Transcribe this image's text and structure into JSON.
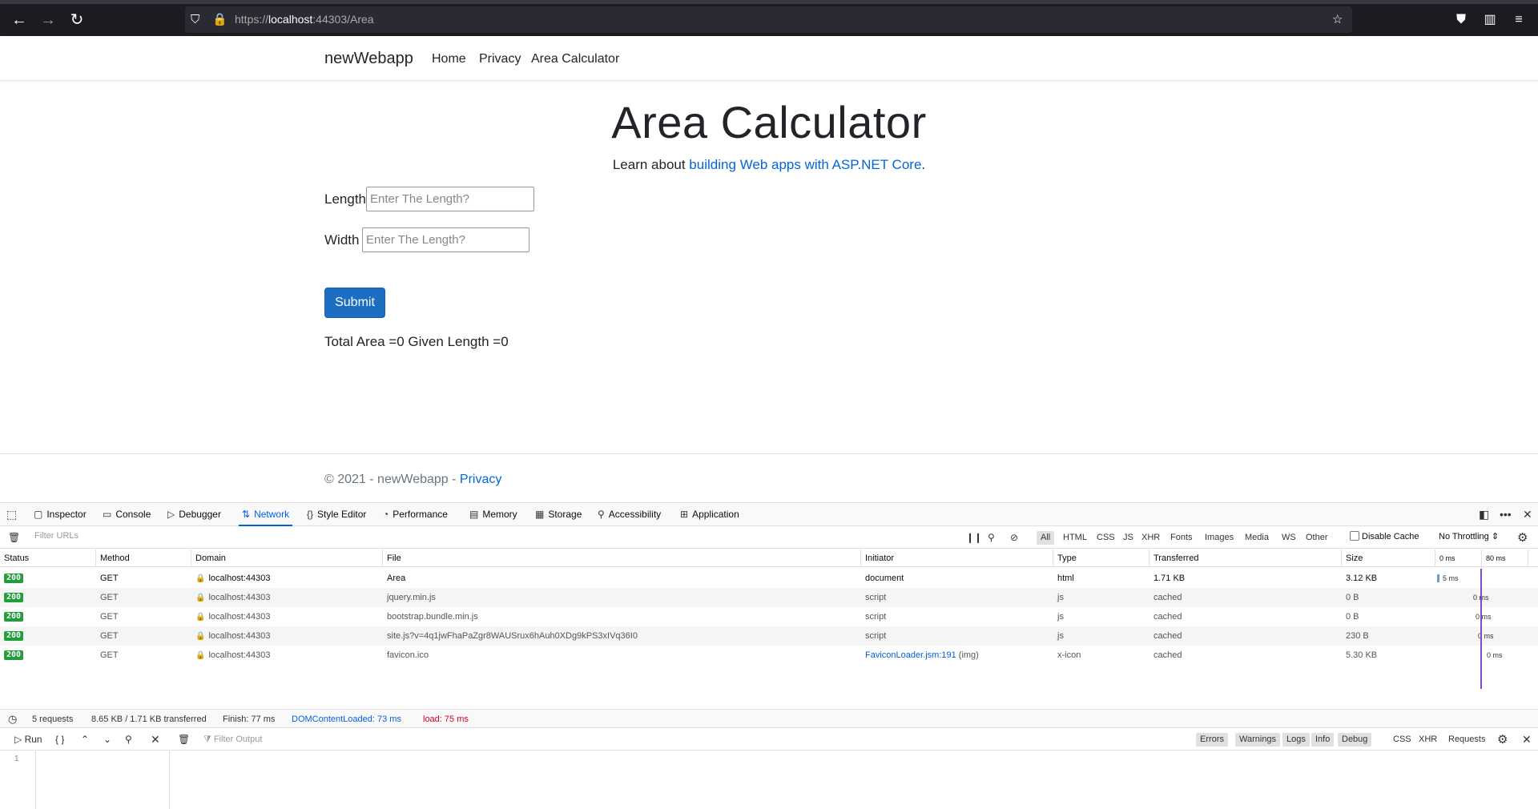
{
  "browser": {
    "url_scheme": "https://",
    "url_host": "localhost",
    "url_rest": ":44303/Area"
  },
  "site": {
    "brand": "newWebapp",
    "nav": [
      "Home",
      "Privacy",
      "Area Calculator"
    ]
  },
  "page": {
    "title": "Area Calculator",
    "lead_text": "Learn about ",
    "lead_link": "building Web apps with ASP.NET Core",
    "lead_end": ".",
    "length_label": "Length",
    "length_placeholder": "Enter The Length?",
    "width_label": "Width",
    "width_placeholder": "Enter The Length?",
    "submit": "Submit",
    "result": "Total Area =0 Given Length =0"
  },
  "footer": {
    "text": "© 2021 - newWebapp - ",
    "link": "Privacy"
  },
  "devtools": {
    "tabs": [
      "Inspector",
      "Console",
      "Debugger",
      "Network",
      "Style Editor",
      "Performance",
      "Memory",
      "Storage",
      "Accessibility",
      "Application"
    ],
    "active_tab": "Network",
    "filter_placeholder": "Filter URLs",
    "filter_types": [
      "All",
      "HTML",
      "CSS",
      "JS",
      "XHR",
      "Fonts",
      "Images",
      "Media",
      "WS",
      "Other"
    ],
    "disable_cache": "Disable Cache",
    "throttling": "No Throttling",
    "columns": [
      "Status",
      "Method",
      "Domain",
      "File",
      "Initiator",
      "Type",
      "Transferred",
      "Size"
    ],
    "waterfall_ticks": [
      "0 ms",
      "80 ms"
    ],
    "requests": [
      {
        "status": "200",
        "method": "GET",
        "domain": "localhost:44303",
        "file": "Area",
        "initiator": "document",
        "initiator_suffix": "",
        "type": "html",
        "transferred": "1.71 KB",
        "size": "3.12 KB",
        "timing": "5 ms",
        "time_ms": 5
      },
      {
        "status": "200",
        "method": "GET",
        "domain": "localhost:44303",
        "file": "jquery.min.js",
        "initiator": "script",
        "initiator_suffix": "",
        "type": "js",
        "transferred": "cached",
        "size": "0 B",
        "timing": "0 ms",
        "time_ms": 0
      },
      {
        "status": "200",
        "method": "GET",
        "domain": "localhost:44303",
        "file": "bootstrap.bundle.min.js",
        "initiator": "script",
        "initiator_suffix": "",
        "type": "js",
        "transferred": "cached",
        "size": "0 B",
        "timing": "0 ms",
        "time_ms": 0
      },
      {
        "status": "200",
        "method": "GET",
        "domain": "localhost:44303",
        "file": "site.js?v=4q1jwFhaPaZgr8WAUSrux6hAuh0XDg9kPS3xIVq36I0",
        "initiator": "script",
        "initiator_suffix": "",
        "type": "js",
        "transferred": "cached",
        "size": "230 B",
        "timing": "0 ms",
        "time_ms": 0
      },
      {
        "status": "200",
        "method": "GET",
        "domain": "localhost:44303",
        "file": "favicon.ico",
        "initiator": "FaviconLoader.jsm:191",
        "initiator_suffix": " (img)",
        "type": "x-icon",
        "transferred": "cached",
        "size": "5.30 KB",
        "timing": "0 ms",
        "time_ms": 0
      }
    ],
    "summary": {
      "requests": "5 requests",
      "transferred": "8.65 KB / 1.71 KB transferred",
      "finish": "Finish: 77 ms",
      "dcl": "DOMContentLoaded: 73 ms",
      "load": "load: 75 ms"
    },
    "console": {
      "run": "Run",
      "braces": "{ }",
      "filter_placeholder": "Filter Output",
      "levels": [
        "Errors",
        "Warnings",
        "Logs",
        "Info",
        "Debug"
      ],
      "extra": [
        "CSS",
        "XHR",
        "Requests"
      ],
      "line": "1"
    }
  },
  "colors": {
    "primary": "#1b6ec2",
    "link": "#0366d6",
    "devtools_active": "#0060df",
    "status_ok": "#1f9e3a",
    "dcl": "#0060df",
    "load": "#d70022"
  }
}
